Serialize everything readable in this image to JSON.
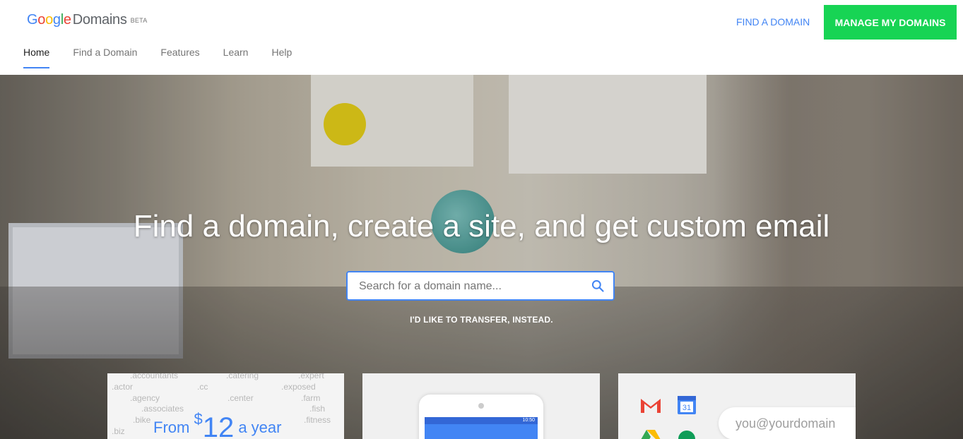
{
  "header": {
    "logo": {
      "brand_letters": [
        "G",
        "o",
        "o",
        "g",
        "l",
        "e"
      ],
      "product": "Domains",
      "badge": "BETA"
    },
    "nav": [
      {
        "label": "Home",
        "active": true
      },
      {
        "label": "Find a Domain",
        "active": false
      },
      {
        "label": "Features",
        "active": false
      },
      {
        "label": "Learn",
        "active": false
      },
      {
        "label": "Help",
        "active": false
      }
    ],
    "find_domain_link": "FIND A DOMAIN",
    "manage_button": "MANAGE MY DOMAINS"
  },
  "hero": {
    "headline": "Find a domain, create a site, and get custom email",
    "search": {
      "placeholder": "Search for a domain name...",
      "icon": "search-icon"
    },
    "transfer_link": "I'D LIKE TO TRANSFER, INSTEAD."
  },
  "cards": {
    "pricing": {
      "tlds": [
        ".accountants",
        ".expert",
        ".actor",
        ".cc",
        ".catering",
        ".exposed",
        ".agency",
        ".center",
        ".farm",
        ".associates",
        ".fish",
        ".bike",
        ".fitness",
        ".biz"
      ],
      "prefix": "From",
      "currency": "$",
      "amount": "12",
      "suffix": "a year"
    },
    "phone": {
      "status_time": "10:50"
    },
    "email": {
      "apps": [
        "gmail-icon",
        "calendar-icon",
        "drive-icon",
        "hangouts-icon"
      ],
      "calendar_day": "31",
      "address": "you@yourdomain"
    }
  },
  "colors": {
    "accent": "#4285f4",
    "manage_button": "#17d454"
  }
}
